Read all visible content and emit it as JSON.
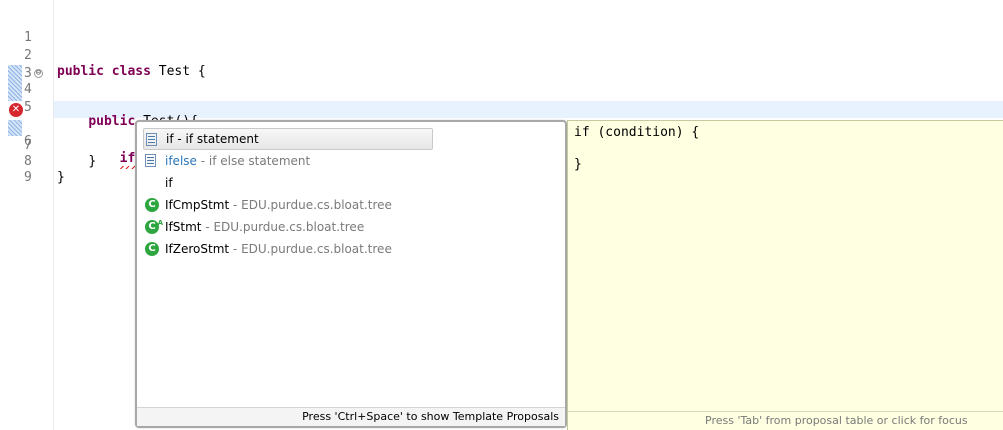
{
  "editor": {
    "lines": [
      {
        "num": "1",
        "code": ""
      },
      {
        "num": "2",
        "kw": "public class",
        "code": " Test {"
      },
      {
        "num": "3",
        "code": ""
      },
      {
        "num": "4",
        "fold": "⊖",
        "indent": "    ",
        "kw": "public",
        "code": " Test(){"
      },
      {
        "num": "5",
        "code": ""
      },
      {
        "num": "6",
        "indent": "        ",
        "code": "if"
      },
      {
        "num": "7",
        "indent": "    ",
        "code": "}"
      },
      {
        "num": "8",
        "code": "}"
      },
      {
        "num": "9",
        "code": ""
      }
    ],
    "error_marker": "✕"
  },
  "content_assist": {
    "proposals": [
      {
        "label": "if",
        "detail": " - if statement",
        "icon": "template-icon",
        "selected": true
      },
      {
        "label": "ifelse",
        "detail": " - if else statement",
        "icon": "template-icon",
        "selected": false
      },
      {
        "label": "if",
        "detail": "",
        "icon": "none",
        "selected": false
      },
      {
        "label": "IfCmpStmt",
        "detail": " - EDU.purdue.cs.bloat.tree",
        "icon": "class-icon",
        "selected": false
      },
      {
        "label": "IfStmt",
        "detail": " - EDU.purdue.cs.bloat.tree",
        "icon": "abstract-class-icon",
        "selected": false
      },
      {
        "label": "IfZeroStmt",
        "detail": " - EDU.purdue.cs.bloat.tree",
        "icon": "class-icon",
        "selected": false
      }
    ],
    "footer": "Press 'Ctrl+Space' to show Template Proposals"
  },
  "info_popup": {
    "code_line1": "if (condition) {",
    "code_line2": "",
    "code_line3": "}",
    "footer": "Press 'Tab' from proposal table or click for focus"
  }
}
